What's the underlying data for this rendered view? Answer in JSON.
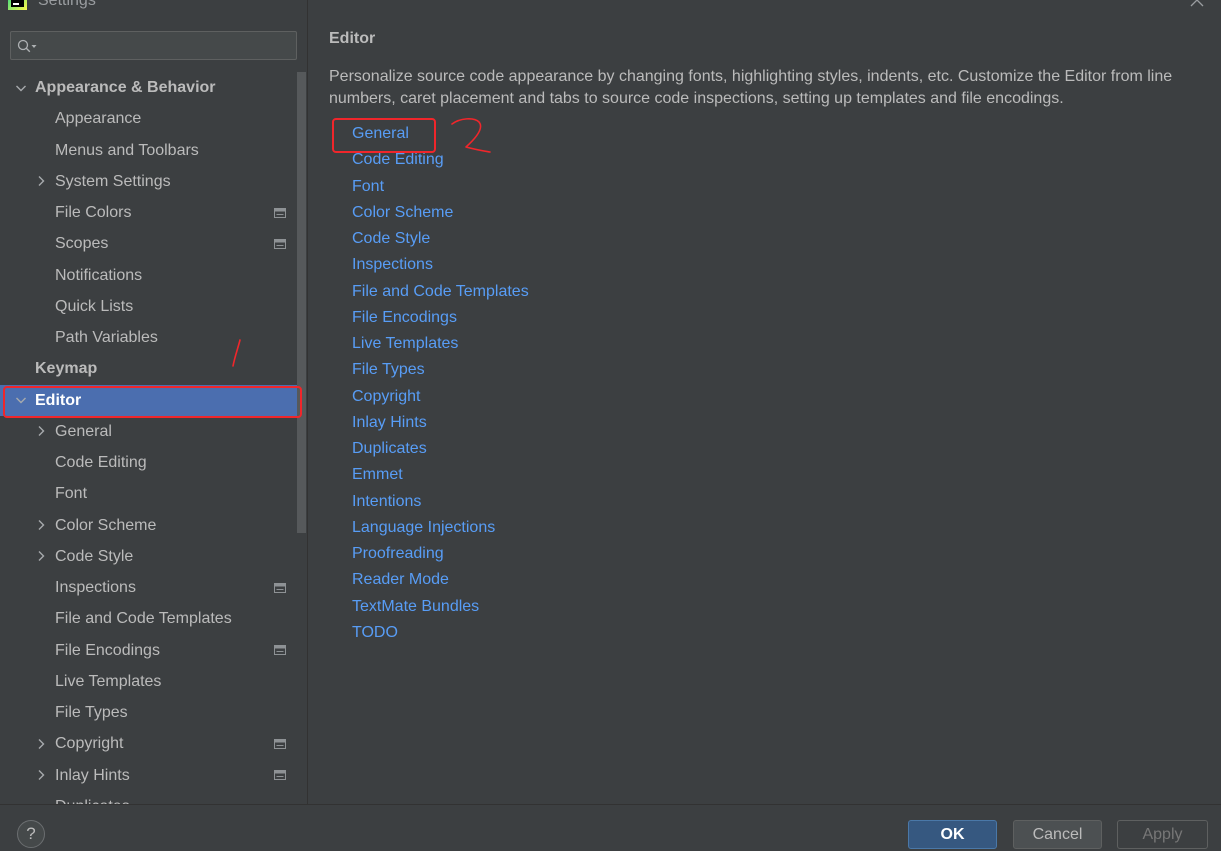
{
  "window": {
    "title": "Settings"
  },
  "icons": {
    "app": "pycharm-logo-icon",
    "close": "close-icon",
    "search": "search-icon",
    "help": "help-icon",
    "expanded": "chevron-down-icon",
    "collapsed": "chevron-right-icon",
    "project_level": "project-level-settings-icon"
  },
  "colors": {
    "background": "#3c3f41",
    "text": "#bbbbbb",
    "selection": "#4b6eaf",
    "link": "#589df6",
    "primary_button": "#365880",
    "secondary_button": "#4c5052",
    "disabled_text": "#777777",
    "annotation": "#f0262b"
  },
  "search": {
    "value": ""
  },
  "sidebar": {
    "tree": [
      {
        "label": "Appearance & Behavior",
        "level": 0,
        "bold": true,
        "expand": "expanded"
      },
      {
        "label": "Appearance",
        "level": 1
      },
      {
        "label": "Menus and Toolbars",
        "level": 1
      },
      {
        "label": "System Settings",
        "level": 1,
        "expand": "collapsed"
      },
      {
        "label": "File Colors",
        "level": 1,
        "project_level": true
      },
      {
        "label": "Scopes",
        "level": 1,
        "project_level": true
      },
      {
        "label": "Notifications",
        "level": 1
      },
      {
        "label": "Quick Lists",
        "level": 1
      },
      {
        "label": "Path Variables",
        "level": 1
      },
      {
        "label": "Keymap",
        "level": 0,
        "bold": true
      },
      {
        "label": "Editor",
        "level": 0,
        "bold": true,
        "expand": "expanded",
        "selected": true,
        "annotated": true
      },
      {
        "label": "General",
        "level": 1,
        "expand": "collapsed"
      },
      {
        "label": "Code Editing",
        "level": 1
      },
      {
        "label": "Font",
        "level": 1
      },
      {
        "label": "Color Scheme",
        "level": 1,
        "expand": "collapsed"
      },
      {
        "label": "Code Style",
        "level": 1,
        "expand": "collapsed"
      },
      {
        "label": "Inspections",
        "level": 1,
        "project_level": true
      },
      {
        "label": "File and Code Templates",
        "level": 1
      },
      {
        "label": "File Encodings",
        "level": 1,
        "project_level": true
      },
      {
        "label": "Live Templates",
        "level": 1
      },
      {
        "label": "File Types",
        "level": 1
      },
      {
        "label": "Copyright",
        "level": 1,
        "expand": "collapsed",
        "project_level": true
      },
      {
        "label": "Inlay Hints",
        "level": 1,
        "expand": "collapsed",
        "project_level": true
      },
      {
        "label": "Duplicates",
        "level": 1
      }
    ]
  },
  "content": {
    "title": "Editor",
    "description": "Personalize source code appearance by changing fonts, highlighting styles, indents, etc. Customize the Editor from line numbers, caret placement and tabs to source code inspections, setting up templates and file encodings.",
    "links": [
      {
        "label": "General",
        "annotated": true
      },
      {
        "label": "Code Editing"
      },
      {
        "label": "Font"
      },
      {
        "label": "Color Scheme"
      },
      {
        "label": "Code Style"
      },
      {
        "label": "Inspections"
      },
      {
        "label": "File and Code Templates"
      },
      {
        "label": "File Encodings"
      },
      {
        "label": "Live Templates"
      },
      {
        "label": "File Types"
      },
      {
        "label": "Copyright"
      },
      {
        "label": "Inlay Hints"
      },
      {
        "label": "Duplicates"
      },
      {
        "label": "Emmet"
      },
      {
        "label": "Intentions"
      },
      {
        "label": "Language Injections"
      },
      {
        "label": "Proofreading"
      },
      {
        "label": "Reader Mode"
      },
      {
        "label": "TextMate Bundles"
      },
      {
        "label": "TODO"
      }
    ]
  },
  "footer": {
    "help_label": "?",
    "ok_label": "OK",
    "cancel_label": "Cancel",
    "apply_label": "Apply",
    "apply_enabled": false
  },
  "annotations": {
    "handwritten_marks": [
      "1",
      "2"
    ]
  }
}
